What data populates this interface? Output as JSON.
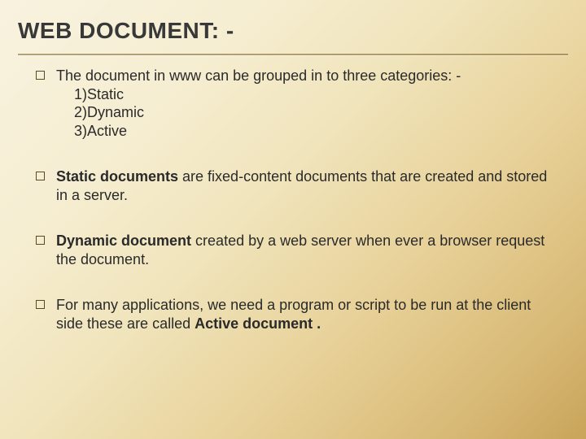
{
  "title": "WEB DOCUMENT: -",
  "bullets": [
    {
      "lead": "The document in www can be grouped in to three categories: -",
      "sub": [
        "1)Static",
        "2)Dynamic",
        "3)Active"
      ]
    },
    {
      "bold_lead": "Static documents",
      "rest": "  are fixed-content documents that are created and stored in a server."
    },
    {
      "bold_lead": "Dynamic document",
      "rest": " created by a web server when ever a browser request the document."
    },
    {
      "pre": "For many applications, we need a program or script to be run at the client side these are called ",
      "bold_tail": "Active document .",
      "post": ""
    }
  ]
}
